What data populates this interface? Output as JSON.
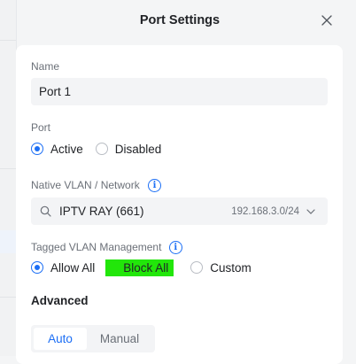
{
  "dialog": {
    "title": "Port Settings"
  },
  "name": {
    "label": "Name",
    "value": "Port 1"
  },
  "port": {
    "label": "Port",
    "options": [
      {
        "label": "Active",
        "checked": true
      },
      {
        "label": "Disabled",
        "checked": false
      }
    ]
  },
  "native_vlan": {
    "label": "Native VLAN / Network",
    "value": "IPTV RAY (661)",
    "subnet": "192.168.3.0/24"
  },
  "tagged_vlan": {
    "label": "Tagged VLAN Management",
    "options": [
      {
        "label": "Allow All",
        "checked": true
      },
      {
        "label": "Block All",
        "checked": false,
        "highlight_color": "#22e60a"
      },
      {
        "label": "Custom",
        "checked": false
      }
    ]
  },
  "advanced": {
    "title": "Advanced",
    "modes": [
      {
        "label": "Auto",
        "active": true
      },
      {
        "label": "Manual",
        "active": false
      }
    ]
  },
  "colors": {
    "accent": "#1b6ef5",
    "highlight": "#22e60a"
  }
}
